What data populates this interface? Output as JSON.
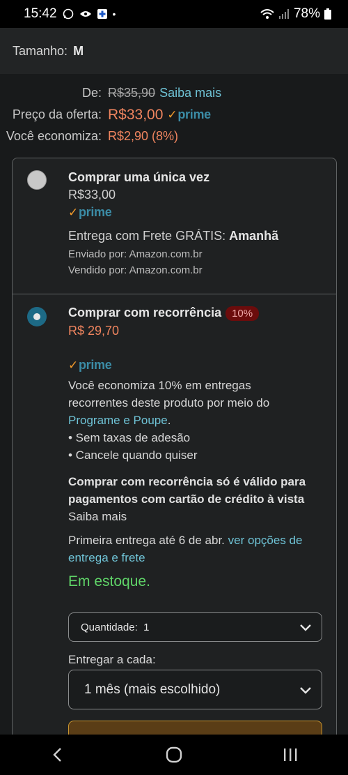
{
  "status_bar": {
    "time": "15:42",
    "battery": "78%"
  },
  "size": {
    "label": "Tamanho:",
    "value": "M"
  },
  "prices": {
    "from_label": "De:",
    "from_value": "R$35,90",
    "learn_more": "Saiba mais",
    "offer_label": "Preço da oferta:",
    "offer_value": "R$33,00",
    "prime_label": "prime",
    "save_label": "Você economiza:",
    "save_value": "R$2,90 (8%)"
  },
  "option_once": {
    "title": "Comprar uma única vez",
    "price": "R$33,00",
    "prime_label": "prime",
    "delivery_prefix": "Entrega com Frete GRÁTIS:",
    "delivery_day": "Amanhã",
    "shipped_by": "Enviado por: Amazon.com.br",
    "sold_by": "Vendido por: Amazon.com.br"
  },
  "option_recurring": {
    "title": "Comprar com recorrência",
    "badge": "10%",
    "price": "R$ 29,70",
    "prime_label": "prime",
    "save_text_1": "Você economiza 10% em entregas",
    "save_text_2": "recorrentes deste produto por meio do",
    "program_link": "Programe e Poupe",
    "program_suffix": ".",
    "bullet_1": "• Sem taxas de adesão",
    "bullet_2": "• Cancele quando quiser",
    "notice_1": "Comprar com recorrência só é válido para",
    "notice_2": "pagamentos com cartão de crédito à vista",
    "notice_link": "Saiba mais",
    "first_delivery": "Primeira entrega até 6 de abr.",
    "delivery_options_link_1": "ver opções de",
    "delivery_options_link_2": "entrega e frete",
    "stock": "Em estoque.",
    "quantity_label": "Quantidade:",
    "quantity_value": "1",
    "frequency_label": "Entregar a cada:",
    "frequency_value": "1 mês (mais escolhido)"
  },
  "colors": {
    "accent_link": "#6fc3d6",
    "price_orange": "#f0855f",
    "stock_green": "#5fd468",
    "prime_blue": "#3b8ca6",
    "badge_red": "#6b0c0c"
  }
}
